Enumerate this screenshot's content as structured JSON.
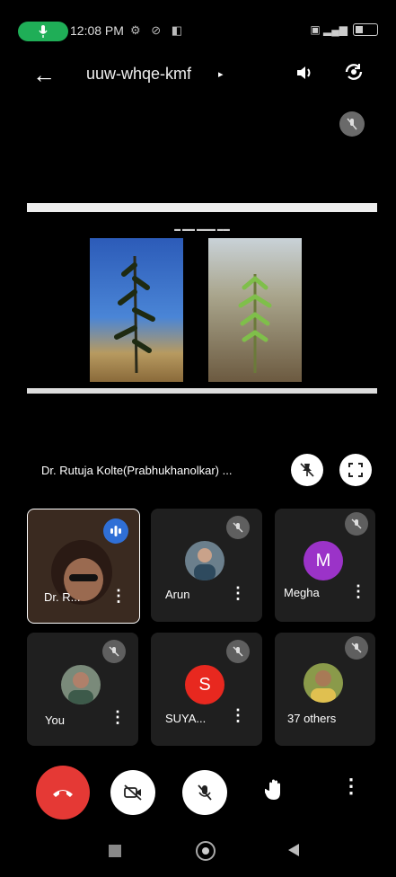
{
  "status_bar": {
    "time": "12:08 PM",
    "icons_left": "⚙ ⊘ ◧"
  },
  "header": {
    "meeting_code": "uuw-whqe-kmf",
    "caret": "▸"
  },
  "presentation": {
    "presenter_name": "Dr. Rutuja Kolte(Prabhukhanolkar) ..."
  },
  "participants": [
    {
      "name": "Dr. R...",
      "speaking": true
    },
    {
      "name": "Arun",
      "muted": true
    },
    {
      "name": "Megha",
      "avatar_letter": "M",
      "avatar_color": "#9b33c8",
      "muted": true
    },
    {
      "name": "You",
      "muted": true
    },
    {
      "name": "SUYA...",
      "avatar_letter": "S",
      "avatar_color": "#e8281f",
      "muted": true
    },
    {
      "name": "37 others",
      "muted": true
    }
  ],
  "colors": {
    "end_call": "#e53935",
    "accent": "#1fae57"
  }
}
